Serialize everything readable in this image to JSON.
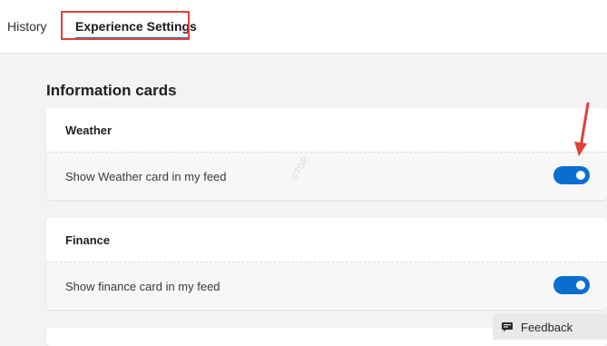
{
  "tabs": [
    {
      "label": "History",
      "active": false
    },
    {
      "label": "Experience Settings",
      "active": true
    }
  ],
  "section": {
    "title": "Information cards"
  },
  "cards": [
    {
      "title": "Weather",
      "row_label": "Show Weather card in my feed",
      "toggle_on": true
    },
    {
      "title": "Finance",
      "row_label": "Show finance card in my feed",
      "toggle_on": true
    }
  ],
  "feedback": {
    "label": "Feedback",
    "icon": "feedback-icon"
  },
  "watermark": "©TGP",
  "colors": {
    "accent": "#0a6ed1",
    "highlight": "#e0403a",
    "tab_underline": "#1a73c8"
  }
}
